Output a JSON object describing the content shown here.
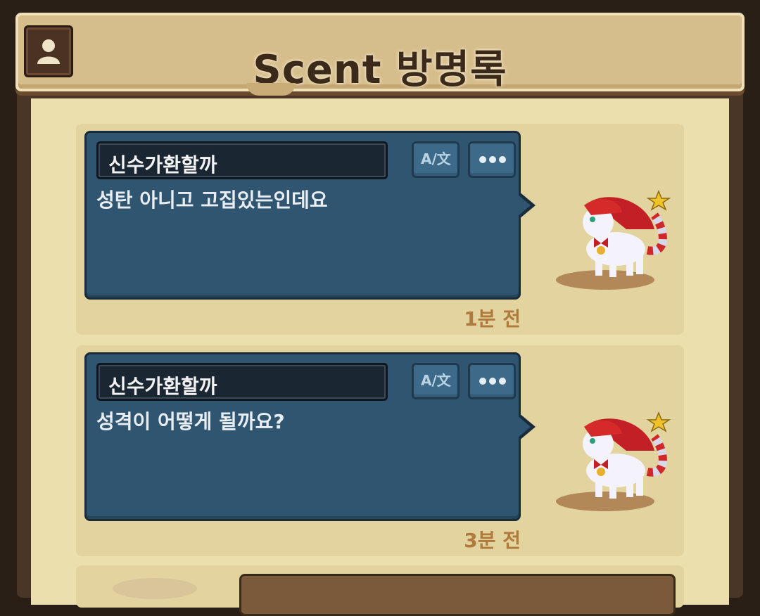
{
  "header": {
    "title": "Scent 방명록",
    "profile_icon": "person-icon"
  },
  "entries": [
    {
      "author": "신수가환할까",
      "message": "성탄 아니고 고집있는인데요",
      "time": "1분 전",
      "translate_label": "A/文",
      "more_label": "•••"
    },
    {
      "author": "신수가환할까",
      "message": "성격이 어떻게 될까요?",
      "time": "3분 전",
      "translate_label": "A/文",
      "more_label": "•••"
    }
  ],
  "colors": {
    "bubble": "#2f5570",
    "header": "#d6bd8c",
    "panel": "#ecdfae",
    "time": "#b07a3c"
  }
}
